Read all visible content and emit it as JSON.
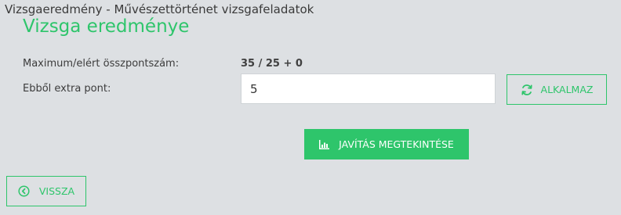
{
  "window": {
    "title": "Vizsgaeredmény - Művészettörténet vizsgafeladatok"
  },
  "page": {
    "title": "Vizsga eredménye"
  },
  "score": {
    "max_label": "Maximum/elért összpontszám:",
    "max_value": "35 / 25 + 0",
    "extra_label": "Ebből extra pont:",
    "extra_value": "5"
  },
  "buttons": {
    "apply_label": "ALKALMAZ",
    "view_corrections_label": "JAVÍTÁS MEGTEKINTÉSE",
    "back_label": "VISSZA"
  },
  "icons": {
    "apply": "refresh-icon",
    "view_corrections": "bar-chart-icon",
    "back": "circle-chevron-left-icon"
  },
  "colors": {
    "accent": "#2ec56b",
    "background": "#dde0e3"
  }
}
